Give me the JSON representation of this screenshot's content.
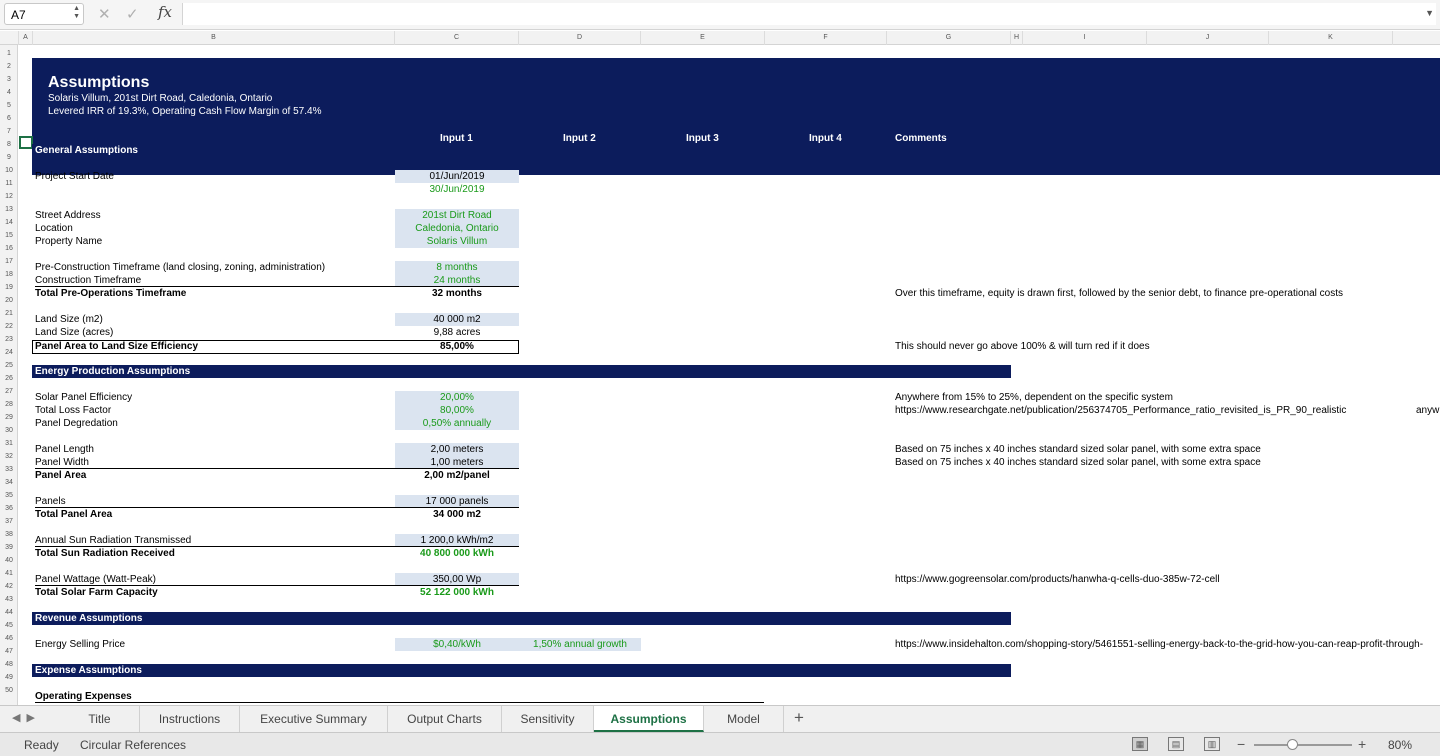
{
  "formula_bar": {
    "name_box": "A7",
    "fx": "fx",
    "formula": ""
  },
  "columns": [
    "A",
    "B",
    "C",
    "D",
    "E",
    "F",
    "G",
    "H",
    "I",
    "J",
    "K"
  ],
  "rows": [
    "1",
    "2",
    "3",
    "4",
    "5",
    "6",
    "7",
    "8",
    "9",
    "10",
    "11",
    "12",
    "13",
    "14",
    "15",
    "16",
    "17",
    "18",
    "19",
    "20",
    "21",
    "22",
    "23",
    "24",
    "25",
    "26",
    "27",
    "28",
    "29",
    "30",
    "31",
    "32",
    "33",
    "34",
    "35",
    "36",
    "37",
    "38",
    "39",
    "40",
    "41",
    "42",
    "43",
    "44",
    "45",
    "46",
    "47",
    "48",
    "49",
    "50"
  ],
  "banner": {
    "title": "Assumptions",
    "subtitle1": "Solaris Villum, 201st Dirt Road, Caledonia, Ontario",
    "subtitle2": "Levered IRR of 19.3%, Operating Cash Flow Margin of 57.4%",
    "headers": [
      "Input 1",
      "Input 2",
      "Input 3",
      "Input 4",
      "Comments"
    ]
  },
  "sections": {
    "general": "General Assumptions",
    "energy": "Energy Production Assumptions",
    "revenue": "Revenue Assumptions",
    "expense": "Expense Assumptions"
  },
  "general": {
    "project_start_label": "Project Start Date",
    "project_start_value": "01/Jun/2019",
    "project_start_value2": "30/Jun/2019",
    "street_label": "Street Address",
    "street_value": "201st Dirt Road",
    "location_label": "Location",
    "location_value": "Caledonia, Ontario",
    "property_label": "Property Name",
    "property_value": "Solaris Villum",
    "precon_label": "Pre-Construction Timeframe (land closing, zoning, administration)",
    "precon_value": "8 months",
    "construction_label": "Construction Timeframe",
    "construction_value": "24 months",
    "total_preops_label": "Total Pre-Operations Timeframe",
    "total_preops_value": "32 months",
    "total_preops_comment": "Over this timeframe, equity is drawn first, followed by the senior debt, to finance pre-operational costs",
    "land_m2_label": "Land Size (m2)",
    "land_m2_value": "40 000 m2",
    "land_acres_label": "Land Size (acres)",
    "land_acres_value": "9,88 acres",
    "panel_eff_label": "Panel Area to Land Size Efficiency",
    "panel_eff_value": "85,00%",
    "panel_eff_comment": "This should never go above 100% & will turn red if it does"
  },
  "energy": {
    "solar_eff_label": "Solar Panel Efficiency",
    "solar_eff_value": "20,00%",
    "solar_eff_comment": "Anywhere from 15% to 25%, dependent on the specific system",
    "loss_label": "Total Loss Factor",
    "loss_value": "80,00%",
    "loss_comment": "https://www.researchgate.net/publication/256374705_Performance_ratio_revisited_is_PR_90_realistic",
    "loss_comment_overflow": "anyw",
    "degradation_label": "Panel Degredation",
    "degradation_value": "0,50% annually",
    "length_label": "Panel Length",
    "length_value": "2,00 meters",
    "length_comment": "Based on 75 inches x 40 inches standard sized solar panel, with some extra space",
    "width_label": "Panel Width",
    "width_value": "1,00 meters",
    "width_comment": "Based on 75 inches x 40 inches standard sized solar panel, with some extra space",
    "area_label": "Panel Area",
    "area_value": "2,00 m2/panel",
    "panels_label": "Panels",
    "panels_value": "17 000 panels",
    "total_area_label": "Total Panel Area",
    "total_area_value": "34 000 m2",
    "sun_trans_label": "Annual Sun Radiation Transmissed",
    "sun_trans_value": "1 200,0 kWh/m2",
    "sun_recv_label": "Total Sun Radiation Received",
    "sun_recv_value": "40 800 000 kWh",
    "wattage_label": "Panel Wattage (Watt-Peak)",
    "wattage_value": "350,00 Wp",
    "wattage_comment": "https://www.gogreensolar.com/products/hanwha-q-cells-duo-385w-72-cell",
    "capacity_label": "Total Solar Farm Capacity",
    "capacity_value": "52 122 000 kWh"
  },
  "revenue": {
    "price_label": "Energy Selling Price",
    "price_value": "$0,40/kWh",
    "growth_value": "1,50% annual growth",
    "price_comment": "https://www.insidehalton.com/shopping-story/5461551-selling-energy-back-to-the-grid-how-you-can-reap-profit-through-"
  },
  "expense": {
    "opex_label": "Operating Expenses"
  },
  "tabs": [
    "Title",
    "Instructions",
    "Executive Summary",
    "Output Charts",
    "Sensitivity",
    "Assumptions",
    "Model"
  ],
  "active_tab": "Assumptions",
  "status": {
    "ready": "Ready",
    "circular": "Circular References",
    "zoom": "80%"
  }
}
